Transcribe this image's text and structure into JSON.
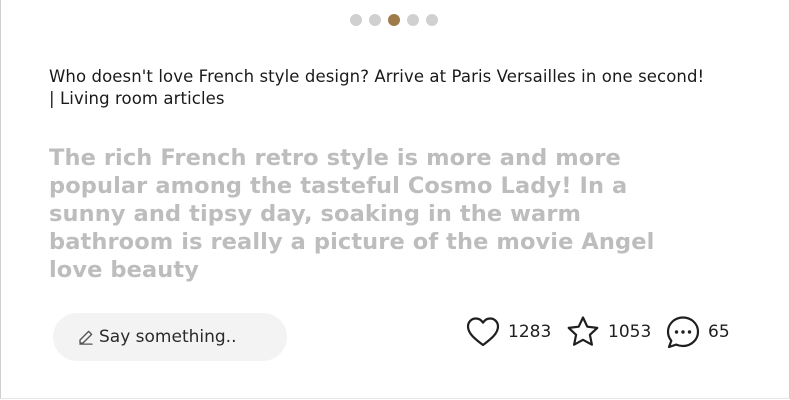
{
  "carousel": {
    "dots": 5,
    "active_index": 2,
    "active_color": "#9e7b4b",
    "inactive_color": "#d0d0d0"
  },
  "article": {
    "title": "Who doesn't love French style design? Arrive at Paris Versailles in one second! | Living room articles",
    "excerpt": "The rich French retro style is more and more popular among the tasteful Cosmo Lady! In a sunny and tipsy day, soaking in the warm bathroom is really a picture of the movie Angel love beauty"
  },
  "comment_input": {
    "placeholder": "Say something..",
    "icon": "pencil-icon"
  },
  "stats": {
    "likes": {
      "icon": "heart-icon",
      "count": "1283"
    },
    "favorites": {
      "icon": "star-icon",
      "count": "1053"
    },
    "comments": {
      "icon": "comment-bubble-icon",
      "count": "65"
    }
  }
}
